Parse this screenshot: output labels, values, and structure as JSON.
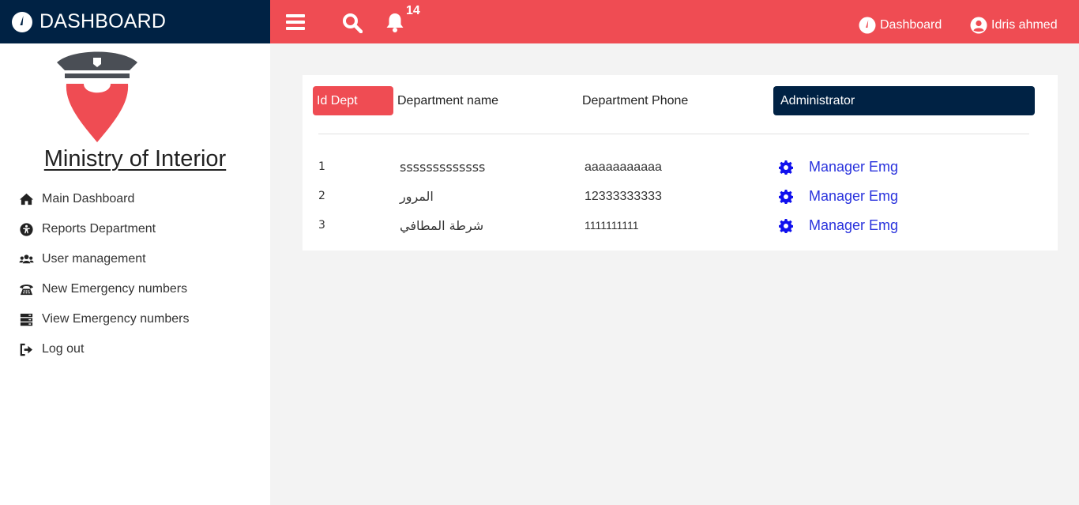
{
  "brand": {
    "title": "DASHBOARD",
    "icon": "tachometer-icon"
  },
  "topbar": {
    "notification_count": "14",
    "dashboard_label": "Dashboard",
    "user_name": "Idris ahmed",
    "icons": [
      "menu-icon",
      "search-icon",
      "bell-icon",
      "tachometer-icon",
      "user-circle-icon"
    ]
  },
  "sidebar": {
    "ministry_title": "Ministry of Interior",
    "items": [
      {
        "label": "Main Dashboard",
        "icon": "home-icon"
      },
      {
        "label": "Reports Department",
        "icon": "universal-access-icon"
      },
      {
        "label": "User management",
        "icon": "users-icon"
      },
      {
        "label": "New Emergency numbers",
        "icon": "phone-icon"
      },
      {
        "label": "View Emergency numbers",
        "icon": "server-icon"
      },
      {
        "label": "Log out",
        "icon": "sign-out-icon"
      }
    ]
  },
  "table": {
    "headers": {
      "id": "Id Dept",
      "name": "Department name",
      "phone": "Department Phone",
      "admin": "Administrator"
    },
    "rows": [
      {
        "id": "1",
        "name": "sssssssssssss",
        "phone": "aaaaaaaaaaa",
        "admin": "Manager Emg"
      },
      {
        "id": "2",
        "name": "المرور",
        "phone": "12333333333",
        "admin": "Manager Emg"
      },
      {
        "id": "3",
        "name": "شرطة المطافي",
        "phone": "1111111111",
        "admin": "Manager Emg"
      }
    ]
  },
  "colors": {
    "navy": "#002244",
    "red": "#ef4c53",
    "link": "#2a33dd",
    "gear": "#1010ee"
  }
}
